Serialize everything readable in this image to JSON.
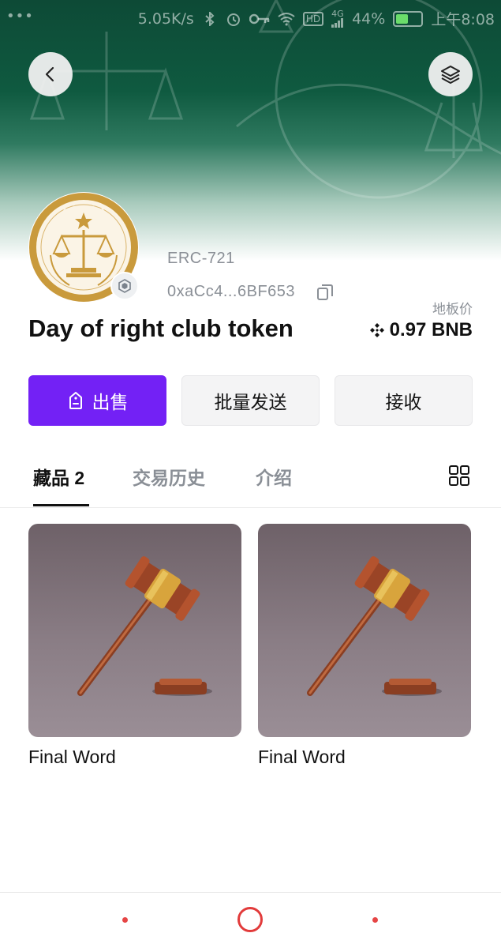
{
  "status_bar": {
    "net_speed": "5.05K/s",
    "network": "4G",
    "hd": "HD",
    "battery_percent": "44%",
    "battery_level": 0.44,
    "time": "上午8:08"
  },
  "header": {
    "back_icon": "chevron-left-icon",
    "layers_icon": "layers-icon"
  },
  "collection": {
    "standard": "ERC-721",
    "address": "0xaCc4...6BF653",
    "name": "Day of right club token",
    "floor_label": "地板价",
    "floor_price": "0.97 BNB",
    "chain_icon": "bnb-chain-icon"
  },
  "actions": {
    "sell_label": "出售",
    "batch_send_label": "批量发送",
    "receive_label": "接收"
  },
  "tabs": [
    {
      "label": "藏品 2",
      "active": true
    },
    {
      "label": "交易历史",
      "active": false
    },
    {
      "label": "介绍",
      "active": false
    }
  ],
  "items": [
    {
      "name": "Final Word"
    },
    {
      "name": "Final Word"
    }
  ],
  "colors": {
    "accent": "#7321f5",
    "banner_green": "#0d4a36",
    "nav_red": "#e23b3b"
  }
}
